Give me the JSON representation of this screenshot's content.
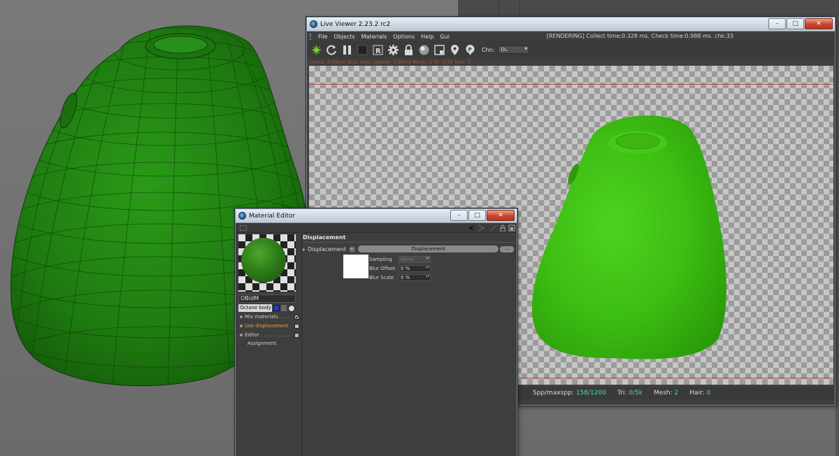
{
  "live_viewer": {
    "title": "Live Viewer 2.23.2 rc2",
    "menu": [
      "File",
      "Objects",
      "Materials",
      "Options",
      "Help",
      "Gui"
    ],
    "status": "[RENDERING] Collect time:0.328 ms.  Check time:0.988 ms.  chk:33",
    "toolbar_icons": [
      "octane-logo-icon",
      "refresh-icon",
      "pause-icon",
      "stop-icon",
      "region-r-icon",
      "settings-gear-icon",
      "lock-icon",
      "material-ball-icon",
      "frame-icon",
      "pin-icon",
      "pin-filter-icon"
    ],
    "channel_label": "Chn:",
    "channel_value": "DL",
    "info_line": "Check: 0.98ms  Geo: 0ms  Update: 3.88ms  Mesh: 2  Tri: 0/5k  Hair: 0",
    "statusbar": {
      "spp_label": "Spp/maxspp:",
      "spp_value": "158/1200",
      "tri_label": "Tri:",
      "tri_value": "0/5k",
      "mesh_label": "Mesh:",
      "mesh_value": "2",
      "hair_label": "Hair:",
      "hair_value": "0"
    },
    "render_color": "#3fbf10"
  },
  "material_editor": {
    "title": "Material Editor",
    "material_name": "OBidM",
    "node_type": "Octane body",
    "channels": [
      {
        "label": "Mix materials . . . .",
        "checked": "✔"
      },
      {
        "label": "Use displacement",
        "checked": ""
      },
      {
        "label": "Editor . . . . . . . . . .",
        "checked": ""
      }
    ],
    "assignment_label": "Assignment",
    "section_title": "Displacement",
    "displacement_label": "Displacement",
    "displacement_button": "Displacement",
    "more_button": "...",
    "params": {
      "sampling_label": "Sampling",
      "sampling_value": "None",
      "blur_offset_label": "Blur Offset",
      "blur_offset_value": "0 %",
      "blur_scale_label": "Blur Scale",
      "blur_scale_value": "0 %"
    },
    "accent_color": "#f0a02c"
  },
  "viewport": {
    "object_color": "#1f7d12",
    "background_color": "#6f6f6f"
  }
}
